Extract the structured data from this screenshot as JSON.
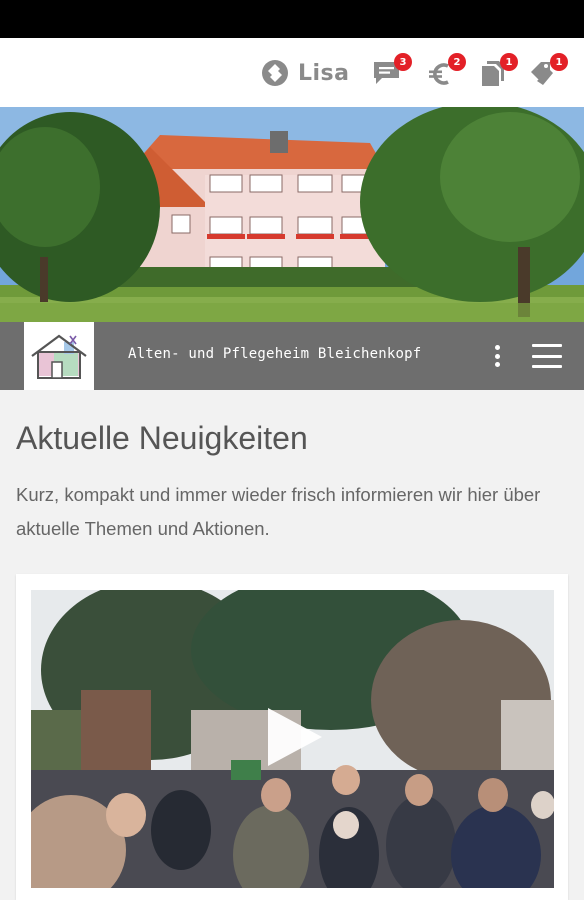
{
  "topbar": {
    "user_name": "Lisa",
    "icons": [
      {
        "name": "messages",
        "badge": "3"
      },
      {
        "name": "payments",
        "badge": "2"
      },
      {
        "name": "documents",
        "badge": "1"
      },
      {
        "name": "tags",
        "badge": "1"
      }
    ]
  },
  "header": {
    "site_title": "Alten- und Pflegeheim Bleichenkopf"
  },
  "main": {
    "title": "Aktuelle Neuigkeiten",
    "intro": "Kurz, kompakt und immer wieder frisch informieren wir hier über aktuelle Themen und Aktionen."
  },
  "colors": {
    "badge": "#e32027",
    "header_band": "#6e6e6e",
    "icon_gray": "#8a8a8a"
  }
}
